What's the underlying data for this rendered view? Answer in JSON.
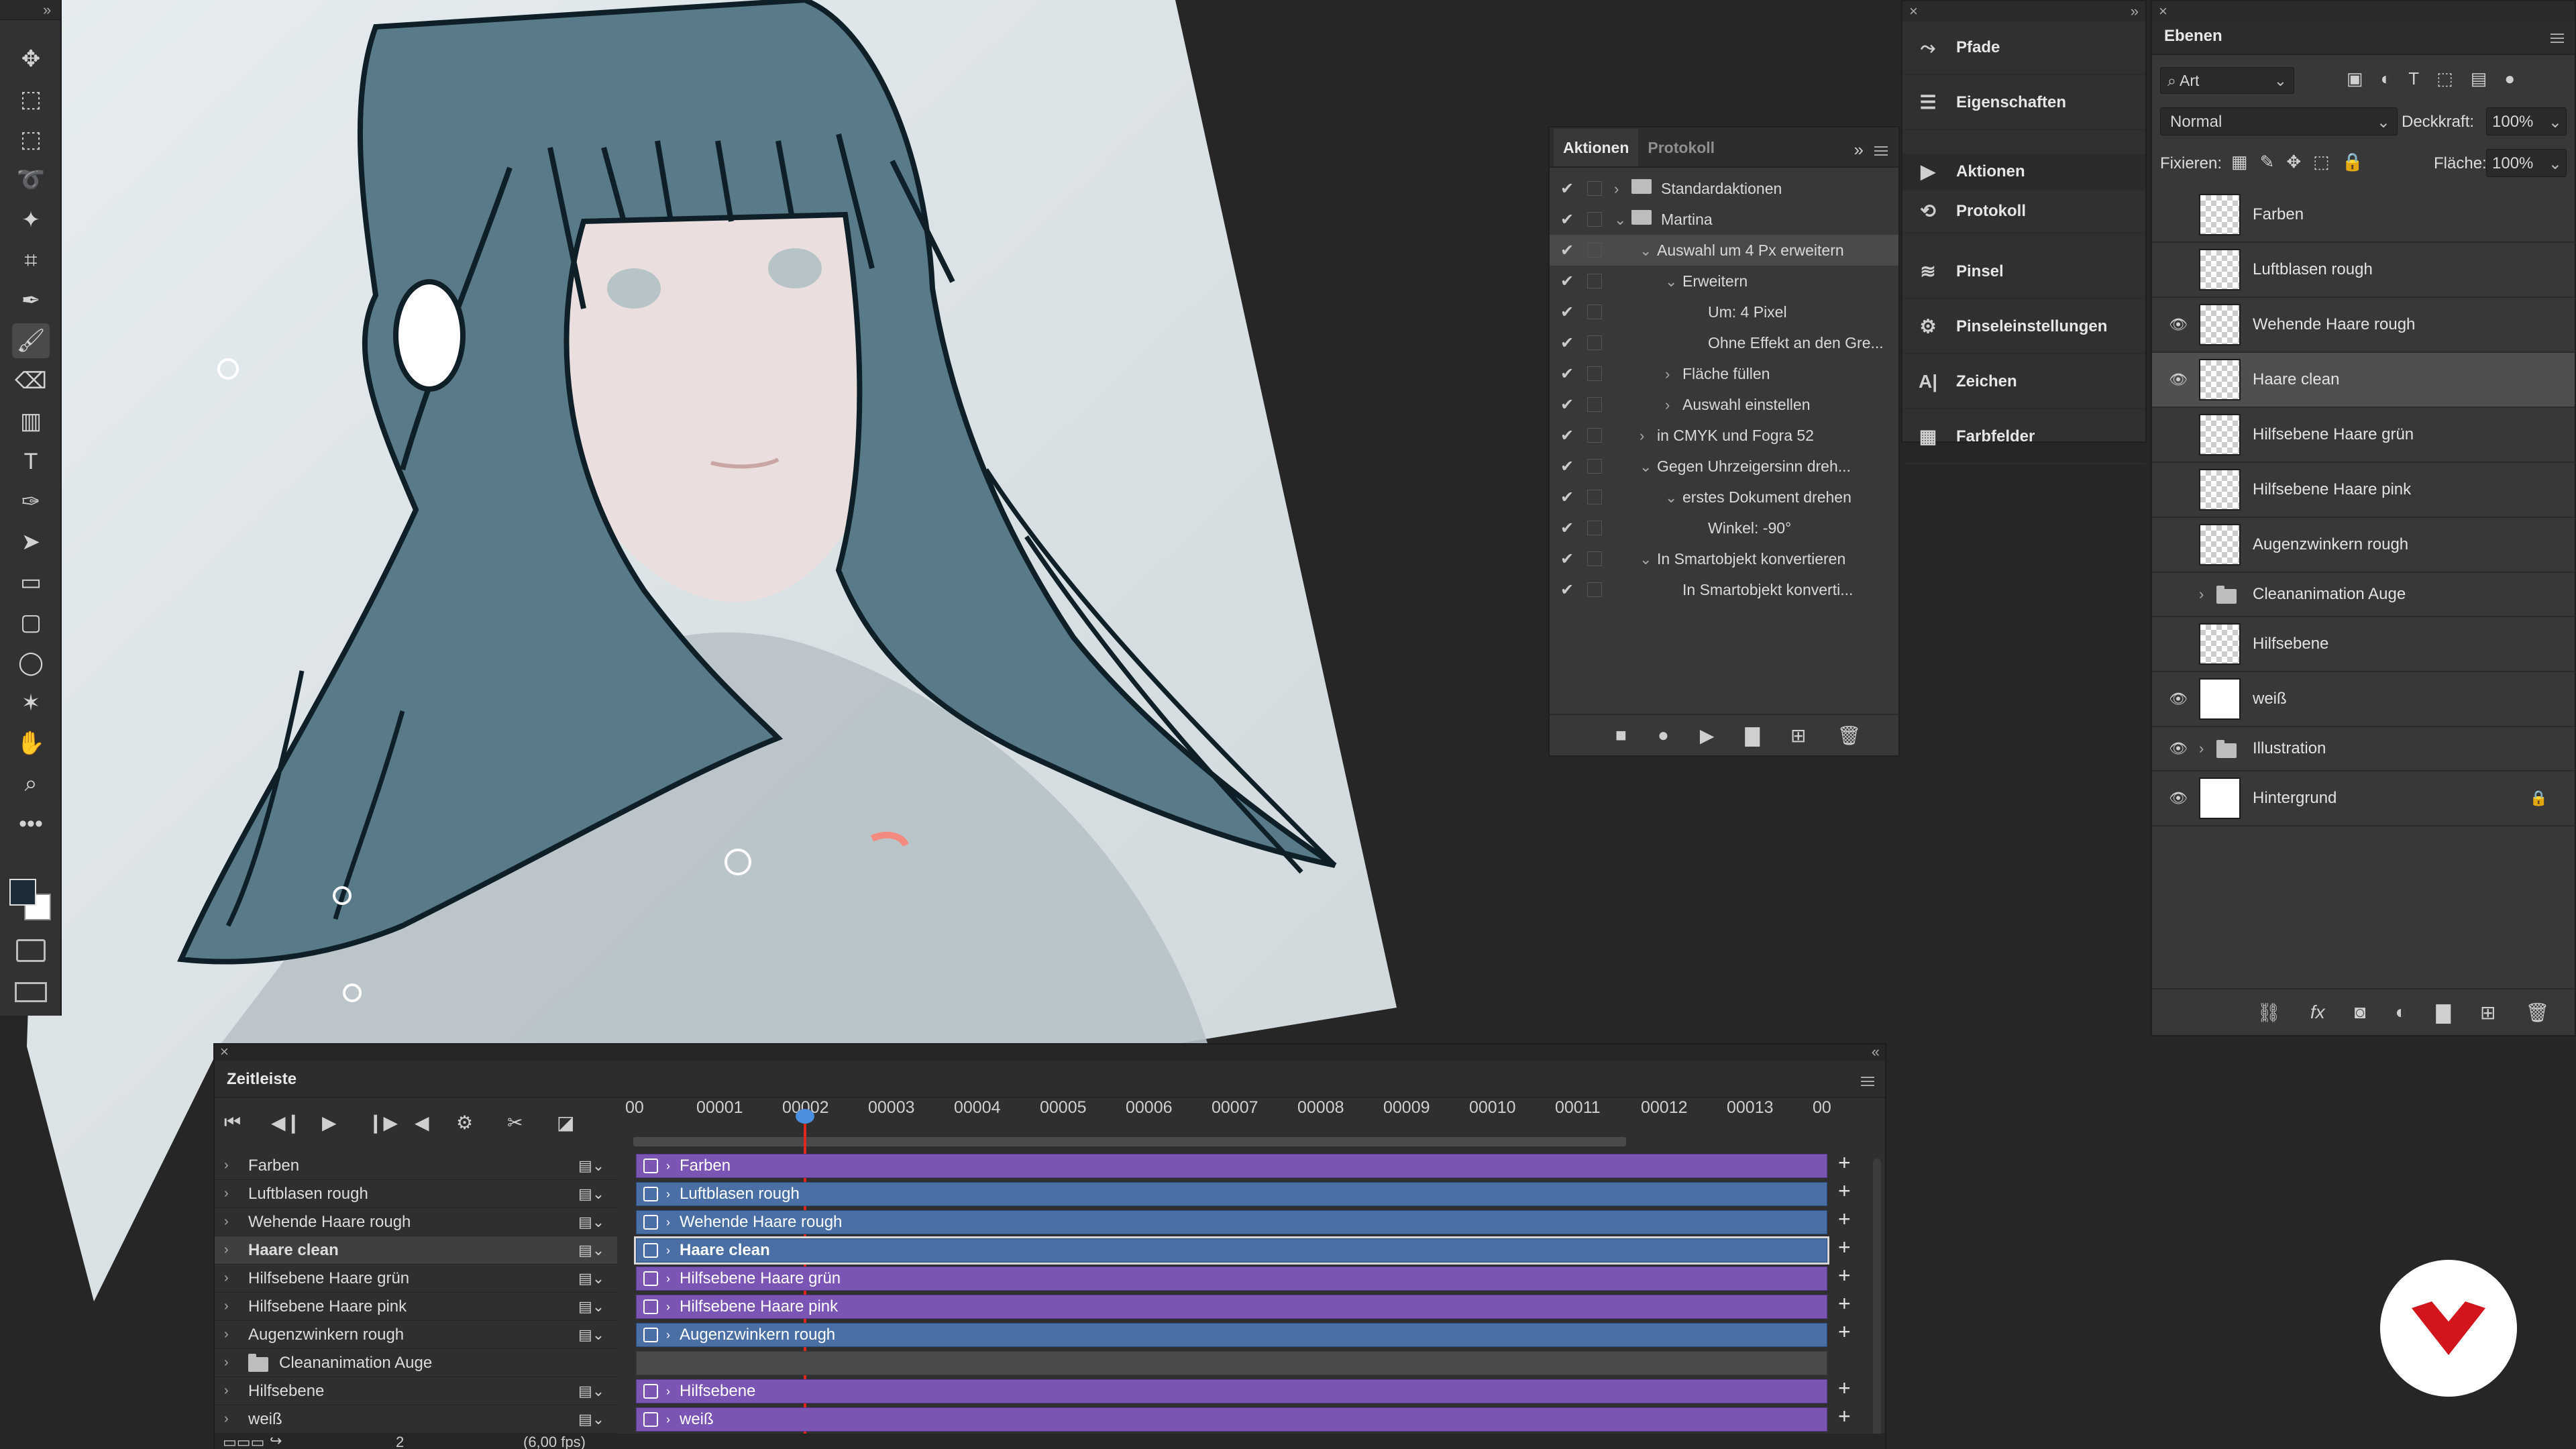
{
  "canvas": {
    "description": "digital illustration of a girl with dark hair"
  },
  "colors": {
    "background": "#262626",
    "panel": "#383838",
    "clip_purple": "#7b55b3",
    "clip_blue": "#4a6fa5",
    "playhead": "#e1261c",
    "hair": "#587a89"
  },
  "toolbar": {
    "tools": [
      "move-icon",
      "artboard-icon",
      "marquee-icon",
      "lasso-icon",
      "magic-wand-icon",
      "crop-icon",
      "eyedropper-icon",
      "brush-icon",
      "eraser-icon",
      "gradient-icon",
      "type-icon",
      "pen-icon",
      "path-select-icon",
      "rectangle-icon",
      "rounded-rect-icon",
      "ellipse-icon",
      "custom-shape-icon",
      "hand-icon",
      "zoom-icon",
      "more-icon"
    ]
  },
  "actions_panel": {
    "tabs": [
      "Aktionen",
      "Protokoll"
    ],
    "rows": [
      {
        "label": "Standardaktionen",
        "level": 0,
        "type": "folder",
        "caret": "›"
      },
      {
        "label": "Martina",
        "level": 0,
        "type": "folder",
        "caret": "⌄"
      },
      {
        "label": "Auswahl um 4 Px erweitern",
        "level": 1,
        "type": "action",
        "caret": "⌄"
      },
      {
        "label": "Erweitern",
        "level": 2,
        "type": "step",
        "caret": "⌄"
      },
      {
        "label": "Um: 4 Pixel",
        "level": 3,
        "type": "detail",
        "caret": ""
      },
      {
        "label": "Ohne Effekt an den Gre...",
        "level": 3,
        "type": "detail",
        "caret": ""
      },
      {
        "label": "Fläche füllen",
        "level": 2,
        "type": "step",
        "caret": "›"
      },
      {
        "label": "Auswahl einstellen",
        "level": 2,
        "type": "step",
        "caret": "›"
      },
      {
        "label": "in CMYK und Fogra 52",
        "level": 1,
        "type": "action",
        "caret": "›"
      },
      {
        "label": "Gegen Uhrzeigersinn dreh...",
        "level": 1,
        "type": "action",
        "caret": "⌄"
      },
      {
        "label": "erstes Dokument drehen",
        "level": 2,
        "type": "step",
        "caret": "⌄"
      },
      {
        "label": "Winkel: -90°",
        "level": 3,
        "type": "detail",
        "caret": ""
      },
      {
        "label": "In Smartobjekt konvertieren",
        "level": 1,
        "type": "action",
        "caret": "⌄"
      },
      {
        "label": "In Smartobjekt konverti...",
        "level": 2,
        "type": "step",
        "caret": ""
      }
    ]
  },
  "side_panel": {
    "items": [
      {
        "label": "Pfade",
        "icon": "paths-icon"
      },
      {
        "label": "Eigenschaften",
        "icon": "properties-icon"
      },
      {
        "label": "Aktionen",
        "icon": "play-icon"
      },
      {
        "label": "Protokoll",
        "icon": "history-icon"
      },
      {
        "label": "Pinsel",
        "icon": "brush-preset-icon"
      },
      {
        "label": "Pinseleinstellungen",
        "icon": "brush-settings-icon"
      },
      {
        "label": "Zeichen",
        "icon": "character-icon"
      },
      {
        "label": "Farbfelder",
        "icon": "swatches-icon"
      }
    ]
  },
  "layers_panel": {
    "tab": "Ebenen",
    "filter_kind": "Art",
    "blend_mode": "Normal",
    "opacity_label": "Deckkraft:",
    "opacity_value": "100%",
    "lock_label": "Fixieren:",
    "fill_label": "Fläche:",
    "fill_value": "100%",
    "layers": [
      {
        "name": "Farben",
        "visible": false,
        "thumb": "checker",
        "group": false,
        "locked": false,
        "selected": false
      },
      {
        "name": "Luftblasen rough",
        "visible": false,
        "thumb": "checker",
        "group": false,
        "locked": false,
        "selected": false
      },
      {
        "name": "Wehende Haare rough",
        "visible": true,
        "thumb": "checker",
        "group": false,
        "locked": false,
        "selected": false
      },
      {
        "name": "Haare clean",
        "visible": true,
        "thumb": "checker",
        "group": false,
        "locked": false,
        "selected": true
      },
      {
        "name": "Hilfsebene Haare grün",
        "visible": false,
        "thumb": "checker",
        "group": false,
        "locked": false,
        "selected": false
      },
      {
        "name": "Hilfsebene Haare pink",
        "visible": false,
        "thumb": "checker",
        "group": false,
        "locked": false,
        "selected": false
      },
      {
        "name": "Augenzwinkern rough",
        "visible": false,
        "thumb": "checker",
        "group": false,
        "locked": false,
        "selected": false
      },
      {
        "name": "Cleananimation Auge",
        "visible": false,
        "thumb": "folder",
        "group": true,
        "locked": false,
        "selected": false
      },
      {
        "name": "Hilfsebene",
        "visible": false,
        "thumb": "checker",
        "group": false,
        "locked": false,
        "selected": false
      },
      {
        "name": "weiß",
        "visible": true,
        "thumb": "white",
        "group": false,
        "locked": false,
        "selected": false
      },
      {
        "name": "Illustration",
        "visible": true,
        "thumb": "folder",
        "group": true,
        "locked": false,
        "selected": false
      },
      {
        "name": "Hintergrund",
        "visible": true,
        "thumb": "white",
        "group": false,
        "locked": true,
        "selected": false
      }
    ]
  },
  "timeline": {
    "title": "Zeitleiste",
    "ruler": [
      "00",
      "00001",
      "00002",
      "00003",
      "00004",
      "00005",
      "00006",
      "00007",
      "00008",
      "00009",
      "00010",
      "00011",
      "00012",
      "00013",
      "00"
    ],
    "current_frame": "2",
    "fps": "(6,00 fps)",
    "tracks": [
      {
        "name": "Farben",
        "clip": "Farben",
        "color": "purple",
        "selected": false,
        "group": false
      },
      {
        "name": "Luftblasen rough",
        "clip": "Luftblasen rough",
        "color": "blue",
        "selected": false,
        "group": false
      },
      {
        "name": "Wehende Haare rough",
        "clip": "Wehende Haare rough",
        "color": "blue",
        "selected": false,
        "group": false
      },
      {
        "name": "Haare clean",
        "clip": "Haare clean",
        "color": "blue",
        "selected": true,
        "group": false
      },
      {
        "name": "Hilfsebene Haare grün",
        "clip": "Hilfsebene Haare grün",
        "color": "purple",
        "selected": false,
        "group": false
      },
      {
        "name": "Hilfsebene Haare pink",
        "clip": "Hilfsebene Haare pink",
        "color": "purple",
        "selected": false,
        "group": false
      },
      {
        "name": "Augenzwinkern rough",
        "clip": "Augenzwinkern rough",
        "color": "blue",
        "selected": false,
        "group": false
      },
      {
        "name": "Cleananimation Auge",
        "clip": "",
        "color": "gray",
        "selected": false,
        "group": true
      },
      {
        "name": "Hilfsebene",
        "clip": "Hilfsebene",
        "color": "purple",
        "selected": false,
        "group": false
      },
      {
        "name": "weiß",
        "clip": "weiß",
        "color": "purple",
        "selected": false,
        "group": false
      }
    ]
  }
}
